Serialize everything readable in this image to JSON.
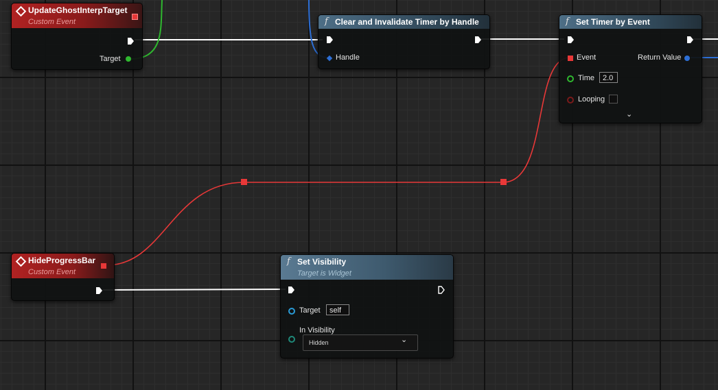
{
  "nodes": {
    "update_ghost": {
      "title": "UpdateGhostInterpTarget",
      "subtitle": "Custom Event",
      "target_label": "Target"
    },
    "clear_timer": {
      "title": "Clear and Invalidate Timer by Handle",
      "handle_label": "Handle"
    },
    "set_timer": {
      "title": "Set Timer by Event",
      "event_label": "Event",
      "return_label": "Return Value",
      "time_label": "Time",
      "time_value": "2.0",
      "looping_label": "Looping",
      "expand_icon": "chevron-down-icon"
    },
    "hide_progress": {
      "title": "HideProgressBar",
      "subtitle": "Custom Event"
    },
    "set_visibility": {
      "title": "Set Visibility",
      "subtitle": "Target is Widget",
      "target_label": "Target",
      "target_value": "self",
      "visibility_label": "In Visibility",
      "visibility_value": "Hidden"
    }
  },
  "colors": {
    "exec_wire": "#ffffff",
    "delegate_wire": "#e83838",
    "object_wire": "#2d6fd6",
    "bool_wire": "#7a1a1a",
    "struct_wire": "#2fb82f",
    "event_header": "#b02222",
    "function_header": "#4d6e86"
  },
  "icons": {
    "event": "diamond-event-icon",
    "function": "function-f-icon"
  }
}
